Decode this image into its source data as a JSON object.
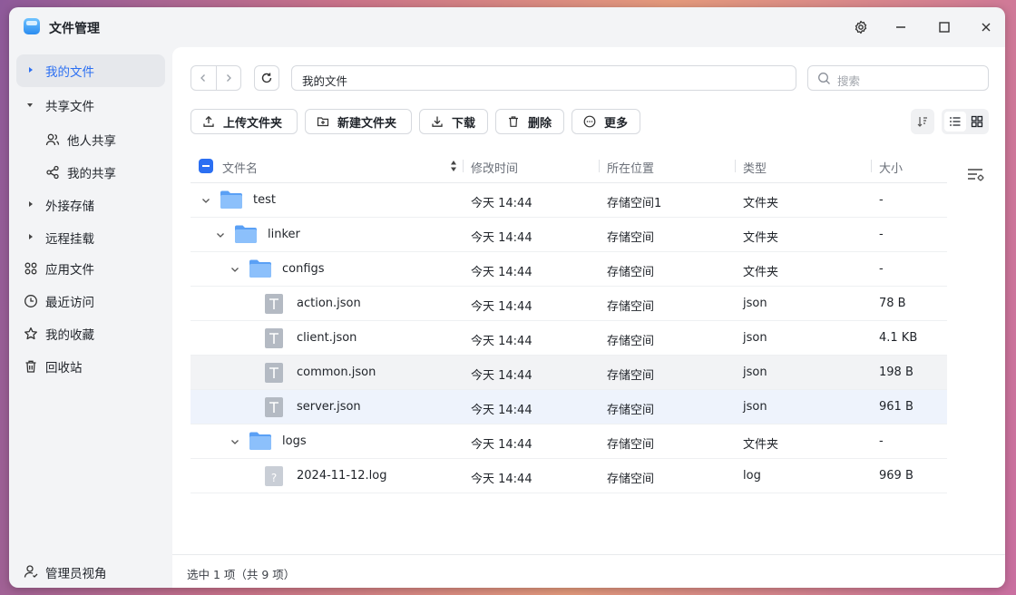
{
  "window": {
    "title": "文件管理"
  },
  "sidebar": {
    "items": [
      {
        "label": "我的文件",
        "active": true,
        "icon": "caret-right-icon"
      },
      {
        "label": "共享文件",
        "icon": "caret-down-icon"
      },
      {
        "label": "他人共享",
        "icon": "users-icon"
      },
      {
        "label": "我的共享",
        "icon": "share-icon"
      },
      {
        "label": "外接存储",
        "icon": "caret-right-icon"
      },
      {
        "label": "远程挂载",
        "icon": "caret-right-icon"
      },
      {
        "label": "应用文件",
        "icon": "apps-icon"
      },
      {
        "label": "最近访问",
        "icon": "clock-icon"
      },
      {
        "label": "我的收藏",
        "icon": "star-icon"
      },
      {
        "label": "回收站",
        "icon": "trash-icon"
      }
    ],
    "footer": {
      "label": "管理员视角",
      "icon": "admin-user-icon"
    }
  },
  "pathbar": {
    "path": "我的文件",
    "search_placeholder": "搜索"
  },
  "toolbar": {
    "upload_folder": "上传文件夹",
    "new_folder": "新建文件夹",
    "download": "下载",
    "delete": "删除",
    "more": "更多"
  },
  "table": {
    "columns": [
      "文件名",
      "修改时间",
      "所在位置",
      "类型",
      "大小"
    ],
    "rows": [
      {
        "name": "test",
        "modified": "今天 14:44",
        "location": "存储空间1",
        "type": "文件夹",
        "size": "-"
      },
      {
        "name": "linker",
        "modified": "今天 14:44",
        "location": "存储空间",
        "type": "文件夹",
        "size": "-"
      },
      {
        "name": "configs",
        "modified": "今天 14:44",
        "location": "存储空间",
        "type": "文件夹",
        "size": "-"
      },
      {
        "name": "action.json",
        "modified": "今天 14:44",
        "location": "存储空间",
        "type": "json",
        "size": "78 B"
      },
      {
        "name": "client.json",
        "modified": "今天 14:44",
        "location": "存储空间",
        "type": "json",
        "size": "4.1 KB"
      },
      {
        "name": "common.json",
        "modified": "今天 14:44",
        "location": "存储空间",
        "type": "json",
        "size": "198 B"
      },
      {
        "name": "server.json",
        "modified": "今天 14:44",
        "location": "存储空间",
        "type": "json",
        "size": "961 B"
      },
      {
        "name": "logs",
        "modified": "今天 14:44",
        "location": "存储空间",
        "type": "文件夹",
        "size": "-"
      },
      {
        "name": "2024-11-12.log",
        "modified": "今天 14:44",
        "location": "存储空间",
        "type": "log",
        "size": "969 B"
      }
    ]
  },
  "status": {
    "text": "选中 1 项（共 9 项）"
  },
  "colors": {
    "accent": "#2b6ff2",
    "folder": "#5aa0f5",
    "selected_row": "#eef3fc"
  }
}
